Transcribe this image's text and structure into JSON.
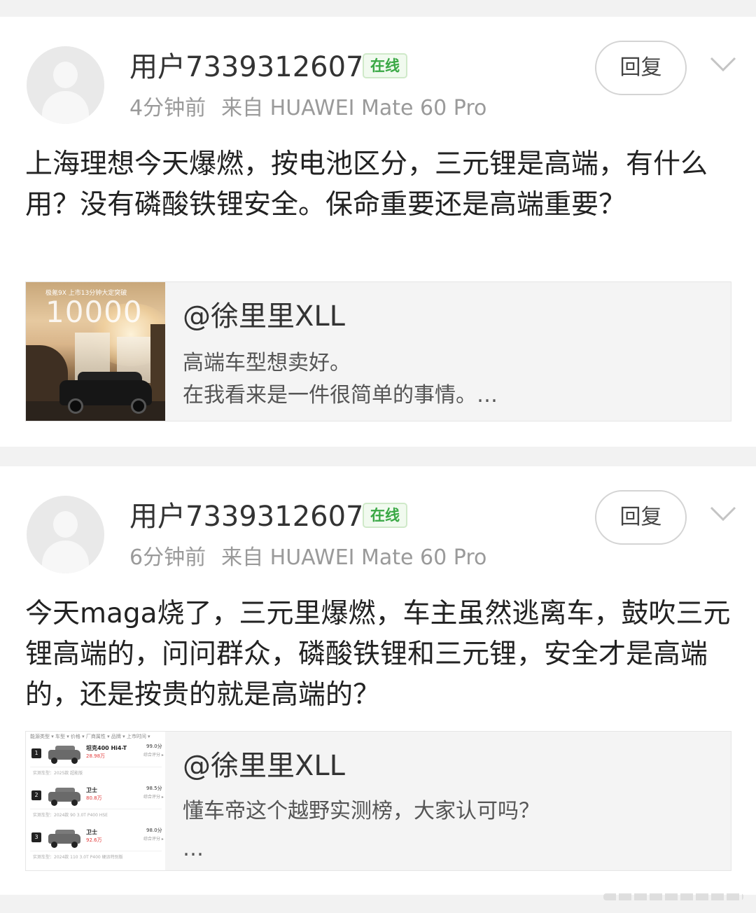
{
  "comments": [
    {
      "username": "用户7339312607",
      "online_badge": "在线",
      "time": "4分钟前",
      "source": "来自 HUAWEI Mate 60 Pro",
      "reply_label": "回复",
      "content": "上海理想今天爆燃，按电池区分，三元锂是高端，有什么用？没有磷酸铁锂安全。保命重要还是高端重要？",
      "quote": {
        "author": "@徐里里XLL",
        "line1": "高端车型想卖好。",
        "line2": "在我看来是一件很简单的事情。…",
        "thumb_small_text": "极氪9X 上市13分钟大定突破",
        "thumb_big_text": "10000"
      }
    },
    {
      "username": "用户7339312607",
      "online_badge": "在线",
      "time": "6分钟前",
      "source": "来自 HUAWEI Mate 60 Pro",
      "reply_label": "回复",
      "content": "今天maga烧了，三元里爆燃，车主虽然逃离车，鼓吹三元锂高端的，问问群众，磷酸铁锂和三元锂，安全才是高端的，还是按贵的就是高端的？",
      "quote": {
        "author": "@徐里里XLL",
        "line1": "懂车帝这个越野实测榜，大家认可吗？",
        "line2": "…",
        "thumb_filters": "能源类型 ▾  车型 ▾  价格 ▾  厂商属性 ▾  品牌 ▾  上市时间 ▾",
        "thumb_rows": [
          {
            "rank": "1",
            "name": "坦克400 Hi4-T",
            "price": "28.98万",
            "score": "99.0分",
            "score_label": "综合评分 ▸",
            "sub": "实测车型：2025款 超能版"
          },
          {
            "rank": "2",
            "name": "卫士",
            "price": "80.8万",
            "score": "98.5分",
            "score_label": "综合评分 ▸",
            "sub": "实测车型：2024款 90 3.0T P400 HSE"
          },
          {
            "rank": "3",
            "name": "卫士",
            "price": "92.6万",
            "score": "98.0分",
            "score_label": "综合评分 ▸",
            "sub": "实测车型：2024款 110 3.0T P400 硬派特别版"
          }
        ]
      }
    }
  ]
}
